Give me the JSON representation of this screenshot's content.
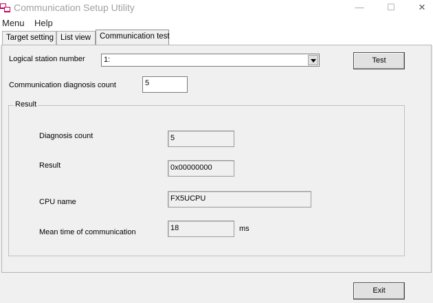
{
  "window": {
    "title": "Communication Setup Utility",
    "minimize": "—",
    "maximize": "☐",
    "close": "✕"
  },
  "menu": [
    "Menu",
    "Help"
  ],
  "tabs": [
    {
      "label": "Target setting",
      "active": false
    },
    {
      "label": "List view",
      "active": false
    },
    {
      "label": "Communication test",
      "active": true
    }
  ],
  "form": {
    "station_label": "Logical station number",
    "station_value": "1:",
    "test_button": "Test",
    "diag_count_label": "Communication diagnosis count",
    "diag_count_value": "5"
  },
  "result": {
    "group_title": "Result",
    "diagnosis_count_label": "Diagnosis count",
    "diagnosis_count_value": "5",
    "result_label": "Result",
    "result_value": "0x00000000",
    "cpu_label": "CPU name",
    "cpu_value": "FX5UCPU",
    "mean_time_label": "Mean time of communication",
    "mean_time_value": "18",
    "mean_time_unit": "ms"
  },
  "footer": {
    "exit_button": "Exit"
  }
}
